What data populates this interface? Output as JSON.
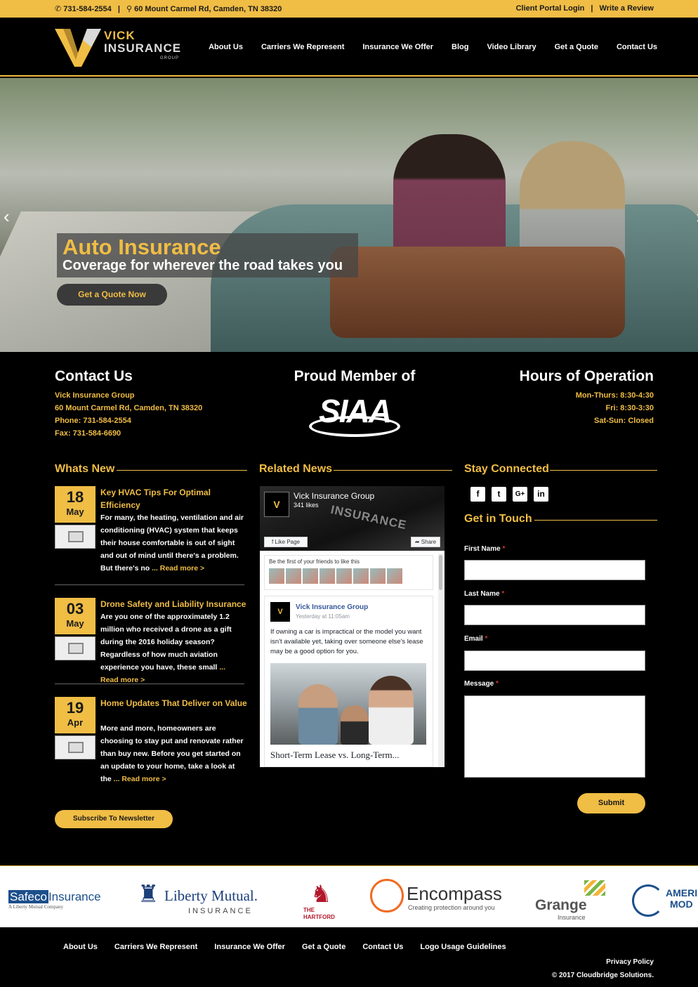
{
  "topbar": {
    "phone": "731-584-2554",
    "address": "60 Mount Carmel Rd, Camden, TN 38320",
    "portal": "Client Portal Login",
    "review": "Write a Review",
    "phone_icon": "phone-icon",
    "map_icon": "map-marker-icon"
  },
  "logo": {
    "line1": "VICK",
    "line2": "INSURANCE",
    "line3": "GROUP",
    "mark": "V"
  },
  "nav": [
    "About Us",
    "Carriers We Represent",
    "Insurance We Offer",
    "Blog",
    "Video Library",
    "Get a Quote",
    "Contact Us"
  ],
  "hero": {
    "title": "Auto Insurance",
    "subtitle": "Coverage for wherever the road takes you",
    "button": "Get a Quote Now",
    "prev_icon": "chevron-left-icon",
    "next_icon": "chevron-right-icon"
  },
  "contact": {
    "heading": "Contact Us",
    "name": "Vick Insurance Group",
    "address": "60 Mount Carmel Rd, Camden, TN 38320",
    "phone": "Phone: 731-584-2554",
    "fax": "Fax: 731-584-6690"
  },
  "member": {
    "heading": "Proud Member of",
    "logo_text": "SIAA"
  },
  "hours": {
    "heading": "Hours of Operation",
    "lines": [
      "Mon-Thurs: 8:30-4:30",
      "Fri: 8:30-3:30",
      "Sat-Sun: Closed"
    ]
  },
  "whats_new": {
    "heading": "Whats New",
    "posts": [
      {
        "day": "18",
        "month": "May",
        "title": "Key HVAC Tips For Optimal Efficiency",
        "body": "For many, the heating, ventilation and air conditioning (HVAC) system that keeps their house comfortable is out of sight and out of mind until there's a problem. But there's no",
        "more": "... Read more >"
      },
      {
        "day": "03",
        "month": "May",
        "title": "Drone Safety and Liability Insurance",
        "body": "Are you one of the approximately 1.2 million who received a drone as a gift during the 2016 holiday season? Regardless of how much aviation experience you have, these small",
        "more": "... Read more >"
      },
      {
        "day": "19",
        "month": "Apr",
        "title": "Home Updates That Deliver on Value",
        "body": "More and more, homeowners are choosing to stay put and renovate rather than buy new. Before you get started on an update to your home, take a look at the",
        "more": "... Read more >"
      }
    ],
    "subscribe": "Subscribe To Newsletter"
  },
  "related": {
    "heading": "Related News",
    "page_name": "Vick Insurance Group",
    "likes": "341 likes",
    "like_btn": "Like Page",
    "share_btn": "Share",
    "friends_text": "Be the first of your friends to like this",
    "post_author": "Vick Insurance Group",
    "post_time": "Yesterday at 11:05am",
    "post_text": "If owning a car is impractical or the model you want isn't available yet, taking over someone else's lease may be a good option for you.",
    "link_title": "Short-Term Lease vs. Long-Term..."
  },
  "stay": {
    "heading": "Stay Connected",
    "icons": [
      {
        "name": "facebook-icon",
        "glyph": "f"
      },
      {
        "name": "twitter-icon",
        "glyph": "t"
      },
      {
        "name": "google-plus-icon",
        "glyph": "G+"
      },
      {
        "name": "linkedin-icon",
        "glyph": "in"
      }
    ]
  },
  "form": {
    "heading": "Get in Touch",
    "first": "First Name",
    "last": "Last Name",
    "email": "Email",
    "message": "Message",
    "required": "*",
    "submit": "Submit"
  },
  "carriers": [
    {
      "main": "Safeco",
      "sub": "Insurance",
      "tag": "A Liberty Mutual Company"
    },
    {
      "main": "Liberty Mutual.",
      "sub": "INSURANCE"
    },
    {
      "main": "THE",
      "sub": "HARTFORD"
    },
    {
      "main": "Encompass",
      "sub": "Creating protection around you"
    },
    {
      "main": "Grange",
      "sub": "Insurance"
    },
    {
      "main": "AMERI",
      "sub": "MOD"
    }
  ],
  "footer": {
    "links": [
      "About Us",
      "Carriers We Represent",
      "Insurance We Offer",
      "Get a Quote",
      "Contact Us",
      "Logo Usage Guidelines"
    ],
    "privacy": "Privacy Policy",
    "copyright": "© 2017 Cloudbridge Solutions."
  },
  "colors": {
    "accent": "#f0bd45",
    "bg": "#000000"
  }
}
